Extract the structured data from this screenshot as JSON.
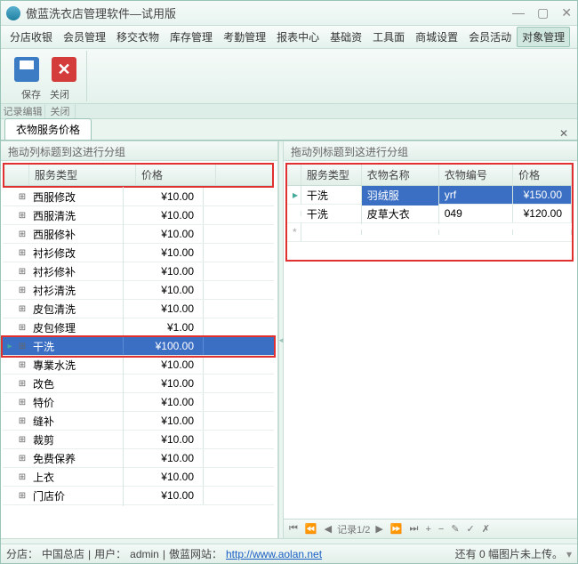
{
  "window": {
    "title": "傲蓝洗衣店管理软件—试用版"
  },
  "menu": {
    "items": [
      "分店收银",
      "会员管理",
      "移交衣物",
      "库存管理",
      "考勤管理",
      "报表中心",
      "基础资",
      "工具面",
      "商城设置",
      "会员活动",
      "对象管理"
    ],
    "activeIndex": 10
  },
  "toolbar": {
    "save": "保存",
    "close": "关闭",
    "group_record": "记录编辑",
    "group_close": "关闭"
  },
  "tab": {
    "label": "衣物服务价格"
  },
  "groupHint": "拖动列标题到这进行分组",
  "leftGrid": {
    "cols": {
      "type": "服务类型",
      "price": "价格"
    },
    "rows": [
      {
        "type": "西服修改",
        "price": "¥10.00"
      },
      {
        "type": "西服清洗",
        "price": "¥10.00"
      },
      {
        "type": "西服修补",
        "price": "¥10.00"
      },
      {
        "type": "衬衫修改",
        "price": "¥10.00"
      },
      {
        "type": "衬衫修补",
        "price": "¥10.00"
      },
      {
        "type": "衬衫清洗",
        "price": "¥10.00"
      },
      {
        "type": "皮包清洗",
        "price": "¥10.00"
      },
      {
        "type": "皮包修理",
        "price": "¥1.00"
      },
      {
        "type": "干洗",
        "price": "¥100.00",
        "selected": true
      },
      {
        "type": "專業水洗",
        "price": "¥10.00"
      },
      {
        "type": "改色",
        "price": "¥10.00"
      },
      {
        "type": "特价",
        "price": "¥10.00"
      },
      {
        "type": "缝补",
        "price": "¥10.00"
      },
      {
        "type": "裁剪",
        "price": "¥10.00"
      },
      {
        "type": "免费保养",
        "price": "¥10.00"
      },
      {
        "type": "上衣",
        "price": "¥10.00"
      },
      {
        "type": "门店价",
        "price": "¥10.00"
      }
    ]
  },
  "rightGrid": {
    "cols": {
      "type": "服务类型",
      "name": "衣物名称",
      "code": "衣物编号",
      "price": "价格"
    },
    "rows": [
      {
        "type": "干洗",
        "name": "羽绒服",
        "code": "yrf",
        "price": "¥150.00",
        "selected": true
      },
      {
        "type": "干洗",
        "name": "皮草大衣",
        "code": "049",
        "price": "¥120.00"
      }
    ],
    "recordLabel": "记录1/2"
  },
  "status": {
    "branch_label": "分店：",
    "branch": "中国总店",
    "user_label": "用户：",
    "user": "admin",
    "site_label": "傲蓝网站：",
    "url": "http://www.aolan.net",
    "upload": "还有 0 幅图片未上传。"
  }
}
